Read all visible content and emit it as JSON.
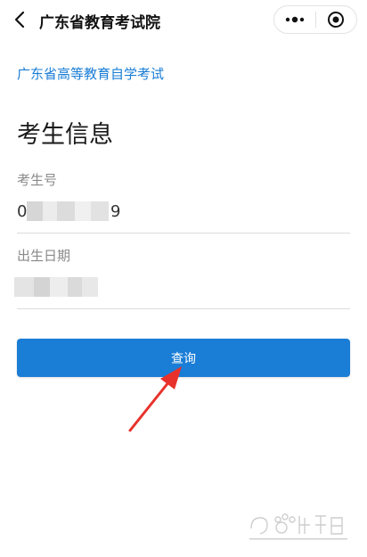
{
  "nav": {
    "title": "广东省教育考试院",
    "back_icon": "chevron-left-icon",
    "more_icon": "more-dots-icon",
    "close_icon": "target-circle-icon"
  },
  "subtitle": "广东省高等教育自学考试",
  "section_title": "考生信息",
  "fields": {
    "candidate_number": {
      "label": "考生号",
      "value_visible_start": "0",
      "value_visible_end": "9"
    },
    "birth_date": {
      "label": "出生日期"
    }
  },
  "query_button": {
    "label": "查询",
    "color": "#1a7dd6"
  },
  "annotation": {
    "arrow_color": "#e8312b"
  },
  "watermark": {
    "name": "baidu-jingyan-watermark"
  }
}
